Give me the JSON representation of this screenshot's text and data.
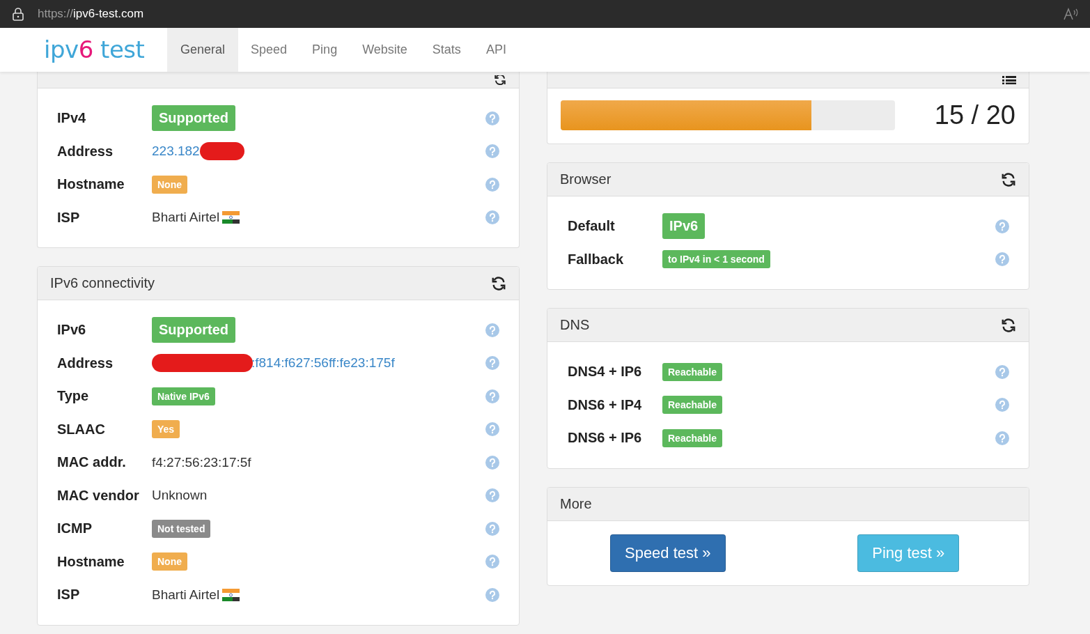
{
  "browser_bar": {
    "url_scheme": "https://",
    "url_host": "ipv6-test.com"
  },
  "nav": {
    "logo": {
      "prefix": "ipv",
      "accent": "6",
      "suffix": " test"
    },
    "tabs": [
      {
        "label": "General",
        "selected": true
      },
      {
        "label": "Speed",
        "selected": false
      },
      {
        "label": "Ping",
        "selected": false
      },
      {
        "label": "Website",
        "selected": false
      },
      {
        "label": "Stats",
        "selected": false
      },
      {
        "label": "API",
        "selected": false
      }
    ]
  },
  "left_panels": [
    {
      "kind": "clipped",
      "rows": [
        {
          "label": "IPv4",
          "value": {
            "kind": "bigbadge",
            "color": "#5cb85c",
            "text": "Supported"
          }
        },
        {
          "label": "Address",
          "value": {
            "kind": "masked",
            "text": "223.182"
          }
        },
        {
          "label": "Hostname",
          "value": {
            "kind": "badge",
            "color": "#f0ad4e",
            "text": "None"
          }
        },
        {
          "label": "ISP",
          "value": {
            "kind": "isp",
            "text": "Bharti Airtel"
          }
        }
      ]
    },
    {
      "kind": "full",
      "title": "IPv6 connectivity",
      "rows": [
        {
          "label": "IPv6",
          "value": {
            "kind": "bigbadge",
            "color": "#5cb85c",
            "text": "Supported"
          }
        },
        {
          "label": "Address",
          "value": {
            "kind": "premasked",
            "text": ":f814:f627:56ff:fe23:175f"
          }
        },
        {
          "label": "Type",
          "value": {
            "kind": "badge",
            "color": "#5cb85c",
            "text": "Native IPv6"
          }
        },
        {
          "label": "SLAAC",
          "value": {
            "kind": "badge",
            "color": "#f0ad4e",
            "text": "Yes"
          }
        },
        {
          "label": "MAC addr.",
          "value": {
            "kind": "text",
            "text": "f4:27:56:23:17:5f"
          }
        },
        {
          "label": "MAC vendor",
          "value": {
            "kind": "text",
            "text": "Unknown"
          }
        },
        {
          "label": "ICMP",
          "value": {
            "kind": "badge",
            "color": "#8a8a8a",
            "text": "Not tested"
          }
        },
        {
          "label": "Hostname",
          "value": {
            "kind": "badge",
            "color": "#f0ad4e",
            "text": "None"
          }
        },
        {
          "label": "ISP",
          "value": {
            "kind": "isp",
            "text": "Bharti Airtel"
          }
        }
      ]
    }
  ],
  "right_panels": [
    {
      "kind": "score",
      "level": 0.75,
      "reading": "15 / 20"
    },
    {
      "kind": "full",
      "title": "Browser",
      "rows": [
        {
          "label": "Default",
          "value": {
            "kind": "bigbadge",
            "color": "#5cb85c",
            "text": "IPv6"
          }
        },
        {
          "label": "Fallback",
          "value": {
            "kind": "badge",
            "color": "#5cb85c",
            "text": "to IPv4 in < 1 second"
          }
        }
      ]
    },
    {
      "kind": "full",
      "title": "DNS",
      "rows": [
        {
          "label": "DNS4 + IP6",
          "value": {
            "kind": "badge",
            "color": "#5cb85c",
            "text": "Reachable"
          }
        },
        {
          "label": "DNS6 + IP4",
          "value": {
            "kind": "badge",
            "color": "#5cb85c",
            "text": "Reachable"
          }
        },
        {
          "label": "DNS6 + IP6",
          "value": {
            "kind": "badge",
            "color": "#5cb85c",
            "text": "Reachable"
          }
        }
      ]
    },
    {
      "kind": "buttons",
      "title": "More",
      "buttons": [
        {
          "label": "Speed test »",
          "color": "#2f6fb0"
        },
        {
          "label": "Ping test »",
          "color": "#4bbbe0"
        }
      ]
    }
  ]
}
